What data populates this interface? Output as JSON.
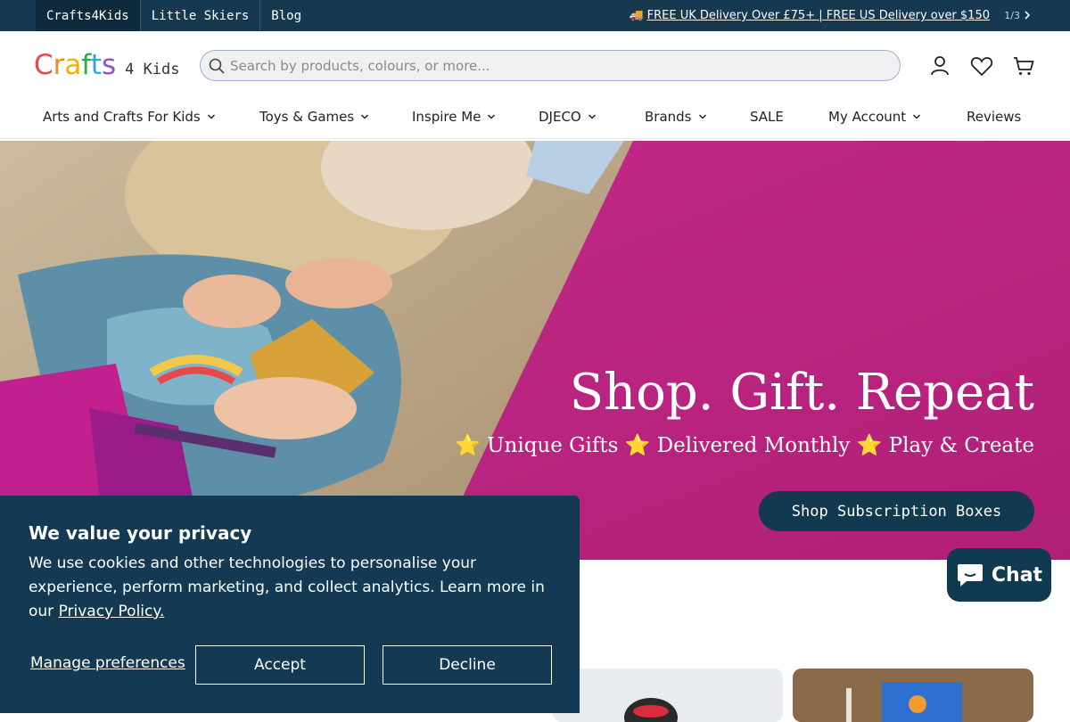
{
  "topbar": {
    "store_tabs": [
      "Crafts4Kids",
      "Little Skiers",
      "Blog"
    ],
    "announcement": "FREE UK Delivery Over £75+ | FREE US Delivery over $150",
    "announcement_icon": "truck-icon",
    "pager": "1/3"
  },
  "header": {
    "logo_main": [
      "C",
      "r",
      "a",
      "f",
      "t",
      "s"
    ],
    "logo_main_colors": [
      "#e5484d",
      "#f08a24",
      "#f2b300",
      "#2fa84f",
      "#2aa7d6",
      "#8b52c9"
    ],
    "logo_sub": "4 Kids",
    "search_placeholder": "Search by products, colours, or more..."
  },
  "nav": {
    "items": [
      {
        "label": "Arts and Crafts For Kids",
        "dropdown": true
      },
      {
        "label": "Toys & Games",
        "dropdown": true
      },
      {
        "label": "Inspire Me",
        "dropdown": true
      },
      {
        "label": "DJECO",
        "dropdown": true
      },
      {
        "label": "Brands",
        "dropdown": true
      },
      {
        "label": "SALE",
        "dropdown": false
      },
      {
        "label": "My Account",
        "dropdown": true
      },
      {
        "label": "Reviews",
        "dropdown": false
      }
    ]
  },
  "hero": {
    "title": "Shop. Gift. Repeat",
    "subtitle": "⭐ Unique Gifts ⭐ Delivered Monthly ⭐ Play & Create",
    "button": "Shop Subscription Boxes",
    "accent": "#c02a86"
  },
  "cookie": {
    "title": "We value your privacy",
    "text": "We use cookies and other technologies to personalise your experience, perform marketing, and collect analytics. Learn more in our ",
    "link": "Privacy Policy.",
    "manage": "Manage preferences",
    "accept": "Accept",
    "decline": "Decline"
  },
  "chat": {
    "label": "Chat"
  },
  "colors": {
    "navy": "#17394f",
    "magenta": "#c02a86"
  }
}
